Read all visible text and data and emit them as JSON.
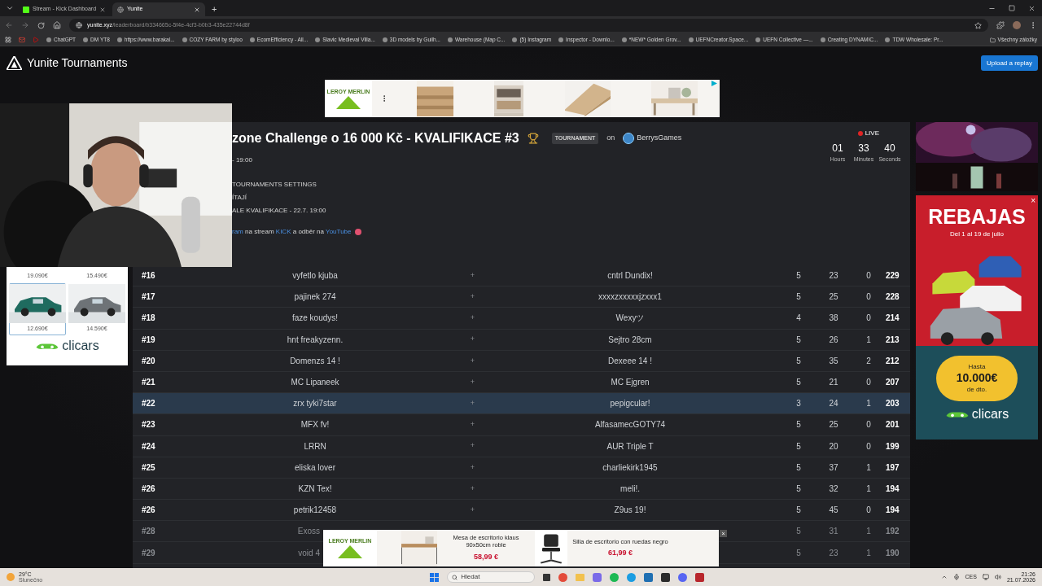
{
  "browser": {
    "tabs": [
      {
        "title": "Stream - Kick Dashboard",
        "selected": false
      },
      {
        "title": "Yunite",
        "selected": true
      }
    ],
    "new_tab": "+",
    "address": {
      "domain": "yunite.xyz",
      "path": "/leaderboard/b334665c-5f4e-4cf3-b0b3-435e22744d8f"
    },
    "bookmarks": [
      "ChatGPT",
      "DM YT8",
      "https://www.barakal...",
      "COZY FARM by styloo",
      "EcomEfficiency - All...",
      "Slavic Medieval Villa...",
      "3D models by Guilh...",
      "Warehouse (Map C...",
      "(5) Instagram",
      "Inspector - Downlo...",
      "*NEW* Golden Grov...",
      "UEFNCreator.Space...",
      "UEFN Collective —...",
      "Creating DYNAMIC...",
      "TDW Wholesale: Pr..."
    ],
    "all_bookmarks": "Všechny záložky"
  },
  "site": {
    "logo": "Yunite Tournaments",
    "upload_button": "Upload a replay"
  },
  "top_ad": {
    "brand": "LEROY MERLIN"
  },
  "tournament": {
    "title": "zone Challenge o 16 000 Kč - KVALIFIKACE #3",
    "badge": "TOURNAMENT",
    "on": "on",
    "host": "BerrysGames",
    "live": "LIVE",
    "countdown": [
      {
        "value": "01",
        "unit": "Hours"
      },
      {
        "value": "33",
        "unit": "Minutes"
      },
      {
        "value": "40",
        "unit": "Seconds"
      }
    ],
    "schedule": "- 19:00",
    "info_lines": [
      "TOURNAMENTS SETTINGS",
      "ÍTAJÍ",
      "ALE KVALIFIKACE - 22.7. 19:00"
    ],
    "promo": [
      {
        "text": "ram",
        "link": true
      },
      {
        "text": "na stream",
        "link": false
      },
      {
        "text": "KICK",
        "link": true
      },
      {
        "text": "a odběr na",
        "link": false
      },
      {
        "text": "YouTube",
        "link": true
      }
    ]
  },
  "leaderboard": {
    "rows": [
      {
        "rank": "#16",
        "player_1": "vyfetlo kjuba",
        "separator": "+",
        "player_2": "cntrl Dundix!",
        "column_1": "5",
        "column_2": "23",
        "column_3": "0",
        "score": "229",
        "selected": false,
        "faded": false
      },
      {
        "rank": "#17",
        "player_1": "pajinek 274",
        "separator": "+",
        "player_2": "xxxxzxxxxxjzxxx1",
        "column_1": "5",
        "column_2": "25",
        "column_3": "0",
        "score": "228",
        "selected": false,
        "faded": false
      },
      {
        "rank": "#18",
        "player_1": "faze koudys!",
        "separator": "+",
        "player_2": "Wexyツ",
        "column_1": "4",
        "column_2": "38",
        "column_3": "0",
        "score": "214",
        "selected": false,
        "faded": false
      },
      {
        "rank": "#19",
        "player_1": "hnt freakyzenn.",
        "separator": "+",
        "player_2": "Sejtro 28cm",
        "column_1": "5",
        "column_2": "26",
        "column_3": "1",
        "score": "213",
        "selected": false,
        "faded": false
      },
      {
        "rank": "#20",
        "player_1": "Domenzs 14 !",
        "separator": "+",
        "player_2": "Dexeee 14 !",
        "column_1": "5",
        "column_2": "35",
        "column_3": "2",
        "score": "212",
        "selected": false,
        "faded": false
      },
      {
        "rank": "#21",
        "player_1": "MC Lipaneek",
        "separator": "+",
        "player_2": "MC Ejgren",
        "column_1": "5",
        "column_2": "21",
        "column_3": "0",
        "score": "207",
        "selected": false,
        "faded": false
      },
      {
        "rank": "#22",
        "player_1": "zrx tyki7star",
        "separator": "+",
        "player_2": "pepigcular!",
        "column_1": "3",
        "column_2": "24",
        "column_3": "1",
        "score": "203",
        "selected": true,
        "faded": false
      },
      {
        "rank": "#23",
        "player_1": "MFX fv!",
        "separator": "+",
        "player_2": "AlfasamecGOTY74",
        "column_1": "5",
        "column_2": "25",
        "column_3": "0",
        "score": "201",
        "selected": false,
        "faded": false
      },
      {
        "rank": "#24",
        "player_1": "LRRN",
        "separator": "+",
        "player_2": "AUR Triple T",
        "column_1": "5",
        "column_2": "20",
        "column_3": "0",
        "score": "199",
        "selected": false,
        "faded": false
      },
      {
        "rank": "#25",
        "player_1": "eliska lover",
        "separator": "+",
        "player_2": "charliekirk1945",
        "column_1": "5",
        "column_2": "37",
        "column_3": "1",
        "score": "197",
        "selected": false,
        "faded": false
      },
      {
        "rank": "#26",
        "player_1": "KZN Tex!",
        "separator": "+",
        "player_2": "meli!.",
        "column_1": "5",
        "column_2": "32",
        "column_3": "1",
        "score": "194",
        "selected": false,
        "faded": false
      },
      {
        "rank": "#26",
        "player_1": "petrik12458",
        "separator": "+",
        "player_2": "Z9us 19!",
        "column_1": "5",
        "column_2": "45",
        "column_3": "0",
        "score": "194",
        "selected": false,
        "faded": false
      },
      {
        "rank": "#28",
        "player_1": "Exoss",
        "column_1": "5",
        "column_2": "31",
        "column_3": "1",
        "score": "192",
        "selected": false,
        "faded": true
      },
      {
        "rank": "#29",
        "player_1": "void 4",
        "column_1": "5",
        "column_2": "23",
        "column_3": "1",
        "score": "190",
        "selected": false,
        "faded": true
      }
    ]
  },
  "left_ad": {
    "items": [
      {
        "price": "19.090€",
        "picture": false,
        "selected": false
      },
      {
        "price": "15.490€",
        "picture": false,
        "selected": false
      },
      {
        "price": "12.690€",
        "picture": true,
        "selected": true
      },
      {
        "price": "14.590€",
        "picture": true,
        "selected": false
      }
    ],
    "brand": "clicars"
  },
  "right_ad": {
    "headline": "REBAJAS",
    "dates": "Del 1 al 19 de julio",
    "offer": [
      "Hasta",
      "10.000€",
      "de dto."
    ],
    "brand": "clicars",
    "close": "×"
  },
  "bottom_ad": {
    "brand": "LEROY MERLIN",
    "products": [
      {
        "name": "Mesa de escritorio klaus 90x50cm roble",
        "price": "58,99 €"
      },
      {
        "name": "Silla de escritorio con ruedas negro",
        "price": "61,99 €"
      }
    ],
    "close": "×"
  },
  "taskbar": {
    "weather": {
      "temp": "29°C",
      "condition": "Slunečno"
    },
    "search": {
      "placeholder": "Hledat"
    },
    "language": "CES",
    "time": "21:26",
    "date": "21.07.2026"
  }
}
